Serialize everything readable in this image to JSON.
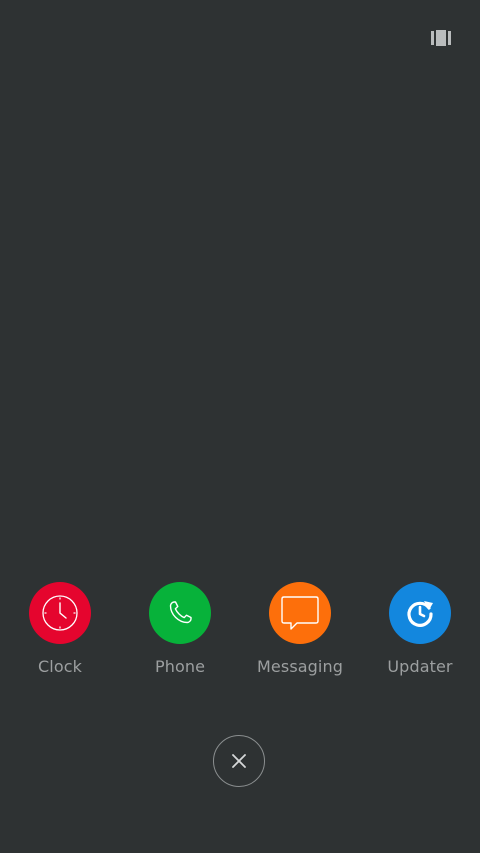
{
  "top_bar": {
    "recents_icon": "recents-icon"
  },
  "apps": [
    {
      "label": "Clock",
      "icon": "clock-icon",
      "color": "#e5052e"
    },
    {
      "label": "Phone",
      "icon": "phone-icon",
      "color": "#07b23a"
    },
    {
      "label": "Messaging",
      "icon": "message-icon",
      "color": "#fd6f0b"
    },
    {
      "label": "Updater",
      "icon": "update-icon",
      "color": "#1387de"
    }
  ],
  "close_button": {
    "icon": "close-icon"
  },
  "colors": {
    "background": "#2e3233",
    "label": "#9c9fa0"
  }
}
